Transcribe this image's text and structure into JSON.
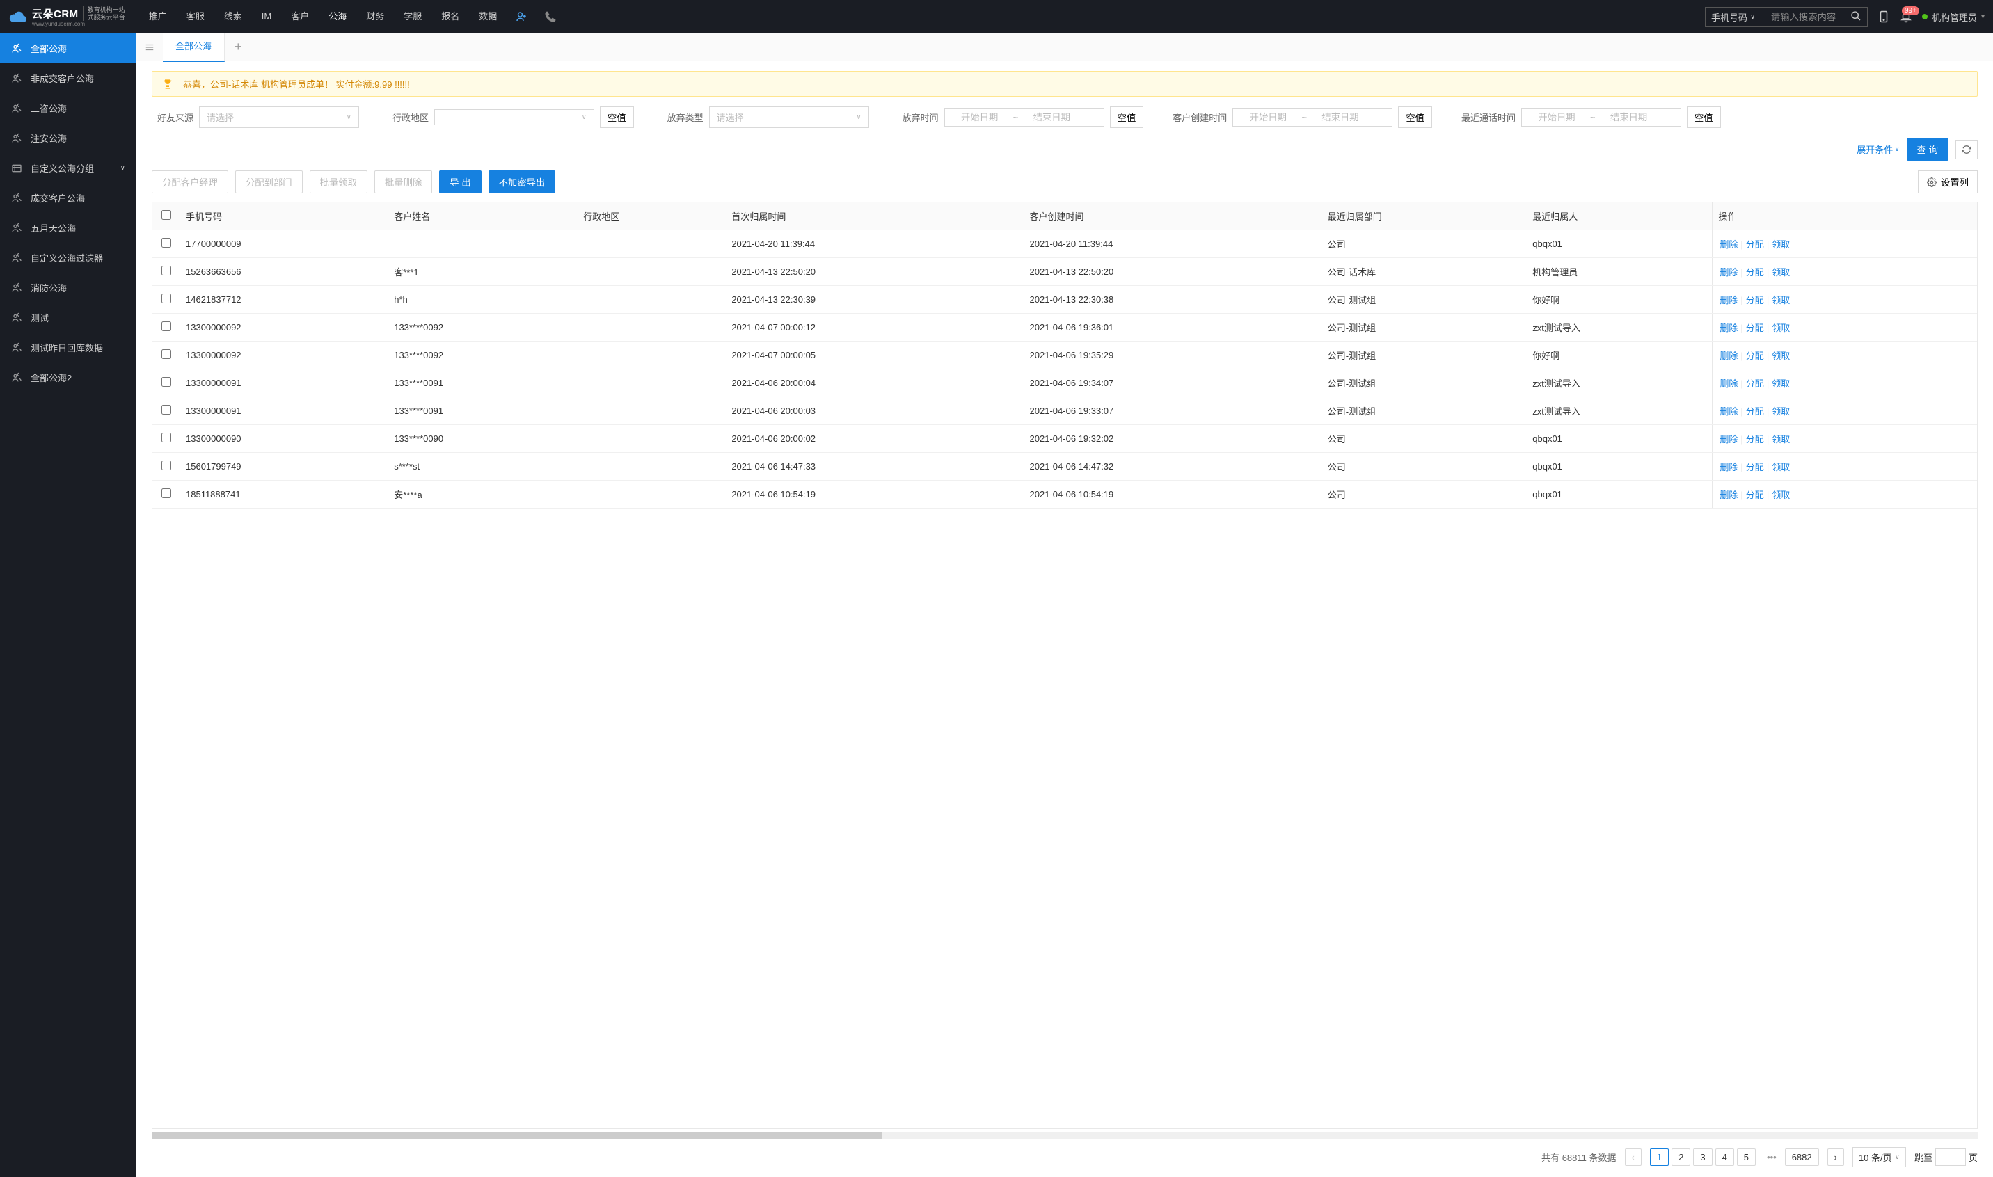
{
  "header": {
    "logo_text": "云朵CRM",
    "logo_sub1": "教育机构一站",
    "logo_sub2": "式服务云平台",
    "logo_url": "www.yunduocrm.com",
    "nav": [
      "推广",
      "客服",
      "线索",
      "IM",
      "客户",
      "公海",
      "财务",
      "学服",
      "报名",
      "数据"
    ],
    "nav_active": 5,
    "search_type": "手机号码",
    "search_placeholder": "请输入搜索内容",
    "badge": "99+",
    "user": "机构管理员"
  },
  "sidebar": {
    "items": [
      {
        "label": "全部公海",
        "icon": "users"
      },
      {
        "label": "非成交客户公海",
        "icon": "users"
      },
      {
        "label": "二咨公海",
        "icon": "users"
      },
      {
        "label": "注安公海",
        "icon": "users"
      },
      {
        "label": "自定义公海分组",
        "icon": "folder",
        "chevron": true
      },
      {
        "label": "成交客户公海",
        "icon": "users"
      },
      {
        "label": "五月天公海",
        "icon": "users"
      },
      {
        "label": "自定义公海过滤器",
        "icon": "users"
      },
      {
        "label": "消防公海",
        "icon": "users"
      },
      {
        "label": "测试",
        "icon": "users"
      },
      {
        "label": "测试昨日回库数据",
        "icon": "users"
      },
      {
        "label": "全部公海2",
        "icon": "users"
      }
    ],
    "active": 0
  },
  "tabs": {
    "items": [
      "全部公海"
    ],
    "active": 0
  },
  "alert": "恭喜，公司-话术库  机构管理员成单！  实付金额:9.99 !!!!!!",
  "filters": {
    "friend_source": {
      "label": "好友来源",
      "placeholder": "请选择"
    },
    "region": {
      "label": "行政地区",
      "empty": "空值"
    },
    "abandon_type": {
      "label": "放弃类型",
      "placeholder": "请选择"
    },
    "abandon_time": {
      "label": "放弃时间",
      "start": "开始日期",
      "end": "结束日期",
      "empty": "空值"
    },
    "create_time": {
      "label": "客户创建时间",
      "start": "开始日期",
      "end": "结束日期",
      "empty": "空值"
    },
    "call_time": {
      "label": "最近通话时间",
      "start": "开始日期",
      "end": "结束日期",
      "empty": "空值"
    },
    "expand": "展开条件",
    "query": "查 询"
  },
  "toolbar": {
    "assign_manager": "分配客户经理",
    "assign_dept": "分配到部门",
    "batch_claim": "批量领取",
    "batch_delete": "批量删除",
    "export": "导 出",
    "export_plain": "不加密导出",
    "settings": "设置列"
  },
  "table": {
    "columns": [
      "手机号码",
      "客户姓名",
      "行政地区",
      "首次归属时间",
      "客户创建时间",
      "最近归属部门",
      "最近归属人",
      "操作"
    ],
    "actions": {
      "delete": "删除",
      "assign": "分配",
      "claim": "领取"
    },
    "rows": [
      {
        "phone": "17700000009",
        "name": "",
        "region": "",
        "first_time": "2021-04-20 11:39:44",
        "create_time": "2021-04-20 11:39:44",
        "dept": "公司",
        "owner": "qbqx01"
      },
      {
        "phone": "15263663656",
        "name": "客***1",
        "region": "",
        "first_time": "2021-04-13 22:50:20",
        "create_time": "2021-04-13 22:50:20",
        "dept": "公司-话术库",
        "owner": "机构管理员"
      },
      {
        "phone": "14621837712",
        "name": "h*h",
        "region": "",
        "first_time": "2021-04-13 22:30:39",
        "create_time": "2021-04-13 22:30:38",
        "dept": "公司-测试组",
        "owner": "你好啊"
      },
      {
        "phone": "13300000092",
        "name": "133****0092",
        "region": "",
        "first_time": "2021-04-07 00:00:12",
        "create_time": "2021-04-06 19:36:01",
        "dept": "公司-测试组",
        "owner": "zxt测试导入"
      },
      {
        "phone": "13300000092",
        "name": "133****0092",
        "region": "",
        "first_time": "2021-04-07 00:00:05",
        "create_time": "2021-04-06 19:35:29",
        "dept": "公司-测试组",
        "owner": "你好啊"
      },
      {
        "phone": "13300000091",
        "name": "133****0091",
        "region": "",
        "first_time": "2021-04-06 20:00:04",
        "create_time": "2021-04-06 19:34:07",
        "dept": "公司-测试组",
        "owner": "zxt测试导入"
      },
      {
        "phone": "13300000091",
        "name": "133****0091",
        "region": "",
        "first_time": "2021-04-06 20:00:03",
        "create_time": "2021-04-06 19:33:07",
        "dept": "公司-测试组",
        "owner": "zxt测试导入"
      },
      {
        "phone": "13300000090",
        "name": "133****0090",
        "region": "",
        "first_time": "2021-04-06 20:00:02",
        "create_time": "2021-04-06 19:32:02",
        "dept": "公司",
        "owner": "qbqx01"
      },
      {
        "phone": "15601799749",
        "name": "s****st",
        "region": "",
        "first_time": "2021-04-06 14:47:33",
        "create_time": "2021-04-06 14:47:32",
        "dept": "公司",
        "owner": "qbqx01"
      },
      {
        "phone": "18511888741",
        "name": "安****a",
        "region": "",
        "first_time": "2021-04-06 10:54:19",
        "create_time": "2021-04-06 10:54:19",
        "dept": "公司",
        "owner": "qbqx01"
      }
    ]
  },
  "pagination": {
    "total_prefix": "共有",
    "total": "68811",
    "total_suffix": "条数据",
    "pages": [
      "1",
      "2",
      "3",
      "4",
      "5"
    ],
    "last_page": "6882",
    "page_size": "10 条/页",
    "jump_prefix": "跳至",
    "jump_suffix": "页"
  }
}
